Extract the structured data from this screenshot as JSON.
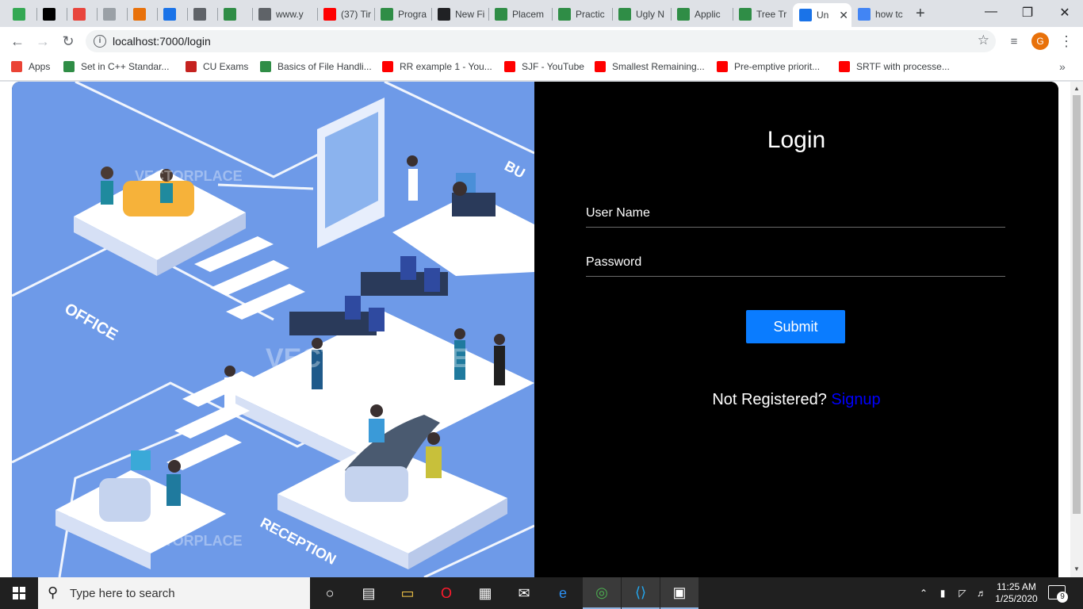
{
  "tabs": [
    {
      "title": "",
      "icon": "play-icon",
      "color": "#34a853"
    },
    {
      "title": "",
      "icon": "medium-logo-icon",
      "color": "#000000"
    },
    {
      "title": "",
      "icon": "bug-icon",
      "color": "#e8453c"
    },
    {
      "title": "",
      "icon": "interviewbit-icon",
      "color": "#9aa0a6"
    },
    {
      "title": "",
      "icon": "fn-icon",
      "color": "#e8710a"
    },
    {
      "title": "",
      "icon": "y-icon",
      "color": "#1a73e8"
    },
    {
      "title": "",
      "icon": "window-icon",
      "color": "#5f6368"
    },
    {
      "title": "",
      "icon": "gfg-icon",
      "color": "#2f8d46"
    },
    {
      "title": "www.y",
      "icon": "video-icon",
      "color": "#5f6368"
    },
    {
      "title": "(37) Tir",
      "icon": "youtube-icon",
      "color": "#ff0000"
    },
    {
      "title": "Progra",
      "icon": "gfg-icon",
      "color": "#2f8d46"
    },
    {
      "title": "New Fi",
      "icon": "github-icon",
      "color": "#202124"
    },
    {
      "title": "Placem",
      "icon": "gfg-icon",
      "color": "#2f8d46"
    },
    {
      "title": "Practic",
      "icon": "gfg-icon",
      "color": "#2f8d46"
    },
    {
      "title": "Ugly N",
      "icon": "gfg-icon",
      "color": "#2f8d46"
    },
    {
      "title": "Applic",
      "icon": "gfg-icon",
      "color": "#2f8d46"
    },
    {
      "title": "Tree Tr",
      "icon": "gfg-icon",
      "color": "#2f8d46"
    },
    {
      "title": "Un",
      "icon": "u-icon",
      "color": "#1a73e8",
      "active": true
    },
    {
      "title": "how tc",
      "icon": "google-icon",
      "color": "#4285f4"
    }
  ],
  "window": {
    "minimize": "—",
    "restore": "❐",
    "close": "✕"
  },
  "toolbar": {
    "url": "localhost:7000/login",
    "profile_initial": "G"
  },
  "bookmarks": [
    {
      "label": "Apps",
      "icon": "apps-grid-icon",
      "color": "#ea4335"
    },
    {
      "label": "Set in C++ Standar...",
      "icon": "gfg-icon",
      "color": "#2f8d46"
    },
    {
      "label": "CU Exams",
      "icon": "cu-icon",
      "color": "#c5221f"
    },
    {
      "label": "Basics of File Handli...",
      "icon": "gfg-icon",
      "color": "#2f8d46"
    },
    {
      "label": "RR example 1 - You...",
      "icon": "youtube-icon",
      "color": "#ff0000"
    },
    {
      "label": "SJF - YouTube",
      "icon": "youtube-icon",
      "color": "#ff0000"
    },
    {
      "label": "Smallest Remaining...",
      "icon": "youtube-icon",
      "color": "#ff0000"
    },
    {
      "label": "Pre-emptive priorit...",
      "icon": "youtube-icon",
      "color": "#ff0000"
    },
    {
      "label": "SRTF with processe...",
      "icon": "youtube-icon",
      "color": "#ff0000"
    }
  ],
  "page": {
    "title": "Login",
    "username_placeholder": "User Name",
    "password_placeholder": "Password",
    "submit_label": "Submit",
    "register_prompt": "Not Registered?",
    "signup_label": "Signup",
    "watermark": "VECTORPLACE",
    "zone_labels": {
      "office": "OFFICE",
      "reception": "RECEPTION",
      "business": "BU"
    }
  },
  "taskbar": {
    "search_placeholder": "Type here to search",
    "time": "11:25 AM",
    "date": "1/25/2020",
    "notification_count": "9",
    "apps": [
      "cortana-icon",
      "task-view-icon",
      "file-explorer-icon",
      "opera-icon",
      "store-icon",
      "mail-icon",
      "edge-icon",
      "chrome-icon",
      "vscode-icon",
      "terminal-icon"
    ]
  },
  "colors": {
    "accent": "#0a7cff",
    "signup_link": "#0000ff",
    "illustration_bg": "#6e9ae8"
  }
}
